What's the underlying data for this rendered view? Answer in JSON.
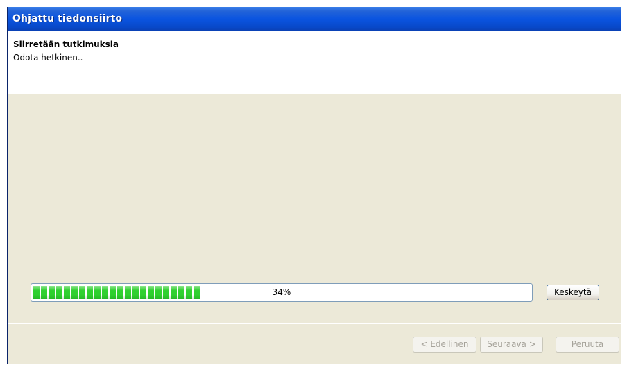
{
  "window": {
    "title": "Ohjattu tiedonsiirto"
  },
  "header": {
    "title": "Siirretään tutkimuksia",
    "subtitle": "Odota hetkinen.."
  },
  "progress": {
    "value": 0.34,
    "label": "34%"
  },
  "buttons": {
    "abort": "Keskeytä",
    "previous": {
      "prefix": "< ",
      "accel": "E",
      "rest": "dellinen"
    },
    "next": {
      "accel": "S",
      "rest": "euraava >"
    },
    "cancel": "Peruuta"
  },
  "colors": {
    "titlebar": "#0a54e0",
    "progress_fill": "#2fd02f",
    "dialog_bg": "#ece9d8"
  }
}
